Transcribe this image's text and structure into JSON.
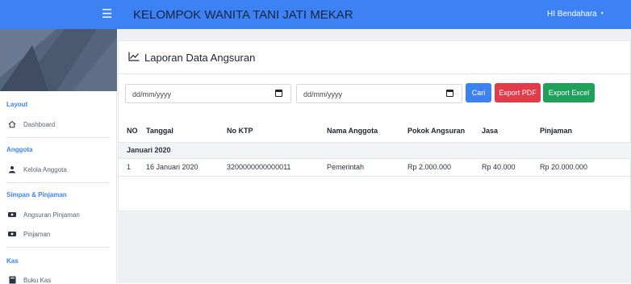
{
  "header": {
    "menu_icon": "hamburger-icon",
    "brand": "KELOMPOK WANITA TANI JATI MEKAR",
    "user": "HI Bendahara",
    "user_caret": "▾"
  },
  "sidebar": {
    "sections": [
      {
        "label": "Layout",
        "items": [
          {
            "label": "Dashboard",
            "icon": "home-icon"
          }
        ]
      },
      {
        "label": "Anggota",
        "items": [
          {
            "label": "Kelola Anggota",
            "icon": "user-icon"
          }
        ]
      },
      {
        "label": "Simpan & Pinjaman",
        "items": [
          {
            "label": "Angsuran Pinjaman",
            "icon": "money-icon"
          },
          {
            "label": "Pinjaman",
            "icon": "money-icon"
          }
        ]
      },
      {
        "label": "Kas",
        "items": [
          {
            "label": "Buku Kas",
            "icon": "book-icon"
          }
        ]
      }
    ]
  },
  "page": {
    "title": "Laporan Data Angsuran",
    "title_icon": "line-chart-icon"
  },
  "filters": {
    "start_date": "dd/mm/yyyy",
    "end_date": "dd/mm/yyyy",
    "search_label": "Cari",
    "export_pdf_label": "Export PDF",
    "export_excel_label": "Export Excel"
  },
  "colors": {
    "primary": "#3d82f4",
    "danger": "#e23b4a",
    "success": "#21a05c"
  },
  "table": {
    "columns": [
      "NO",
      "Tanggal",
      "No KTP",
      "Nama Anggota",
      "Pokok Angsuran",
      "Jasa",
      "Pinjaman"
    ],
    "groups": [
      {
        "label": "Januari 2020",
        "rows": [
          {
            "no": "1",
            "tanggal": "16 Januari 2020",
            "ktp": "3200000000000011",
            "nama": "Pemerintah",
            "pokok": "Rp 2.000.000",
            "jasa": "Rp 40.000",
            "pinjaman": "Rp 20.000.000"
          }
        ]
      }
    ]
  }
}
